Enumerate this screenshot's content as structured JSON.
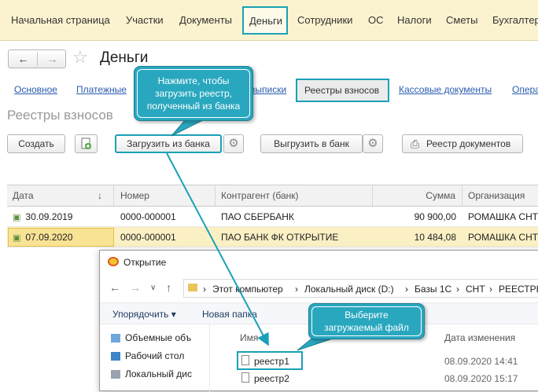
{
  "topnav": {
    "items": [
      "Начальная страница",
      "Участки",
      "Документы",
      "Деньги",
      "Сотрудники",
      "ОС",
      "Налоги",
      "Сметы",
      "Бухгалтер"
    ]
  },
  "header": {
    "back": "←",
    "forward": "→",
    "star": "☆",
    "title": "Деньги"
  },
  "sections": {
    "items": [
      "Основное",
      "Платежные",
      "выписки",
      "Реестры взносов",
      "Кассовые документы",
      "Опера"
    ]
  },
  "form_title": "Реестры взносов",
  "toolbar": {
    "create": "Создать",
    "upload": "Загрузить из банка",
    "download": "Выгрузить в банк",
    "registry": "Реестр документов"
  },
  "table": {
    "headers": [
      "Дата",
      "↓",
      "Номер",
      "Контрагент (банк)",
      "Сумма",
      "Организация"
    ],
    "rows": [
      {
        "date": "30.09.2019",
        "number": "0000-000001",
        "bank": "ПАО СБЕРБАНК",
        "sum": "90 900,00",
        "org": "РОМАШКА СНТ"
      },
      {
        "date": "07.09.2020",
        "number": "0000-000001",
        "bank": "ПАО БАНК ФК ОТКРЫТИЕ",
        "sum": "10 484,08",
        "org": "РОМАШКА СНТ"
      }
    ]
  },
  "dialog": {
    "title": "Открытие",
    "path": [
      "Этот компьютер",
      "Локальный диск (D:)",
      "Базы 1С",
      "СНТ",
      "РЕЕСТРЫ"
    ],
    "organize": "Упорядочить ▾",
    "new_folder": "Новая папка",
    "nav_items": [
      "Объемные объ",
      "Рабочий стол",
      "Локальный дис"
    ],
    "col_name": "Имя",
    "col_date": "Дата изменения",
    "files": [
      {
        "name": "реестр1",
        "date": "08.09.2020 14:41"
      },
      {
        "name": "реестр2",
        "date": "08.09.2020 15:17"
      }
    ]
  },
  "callouts": {
    "upload_hint": "Нажмите, чтобы загрузить реестр, полученный из банка",
    "file_hint": "Выберите загружаемый файл"
  },
  "colors": {
    "accent": "#1aa0b7",
    "callout": "#29a7bf",
    "topnav_bg": "#fbf3cf",
    "selection": "#fbf0c4"
  }
}
